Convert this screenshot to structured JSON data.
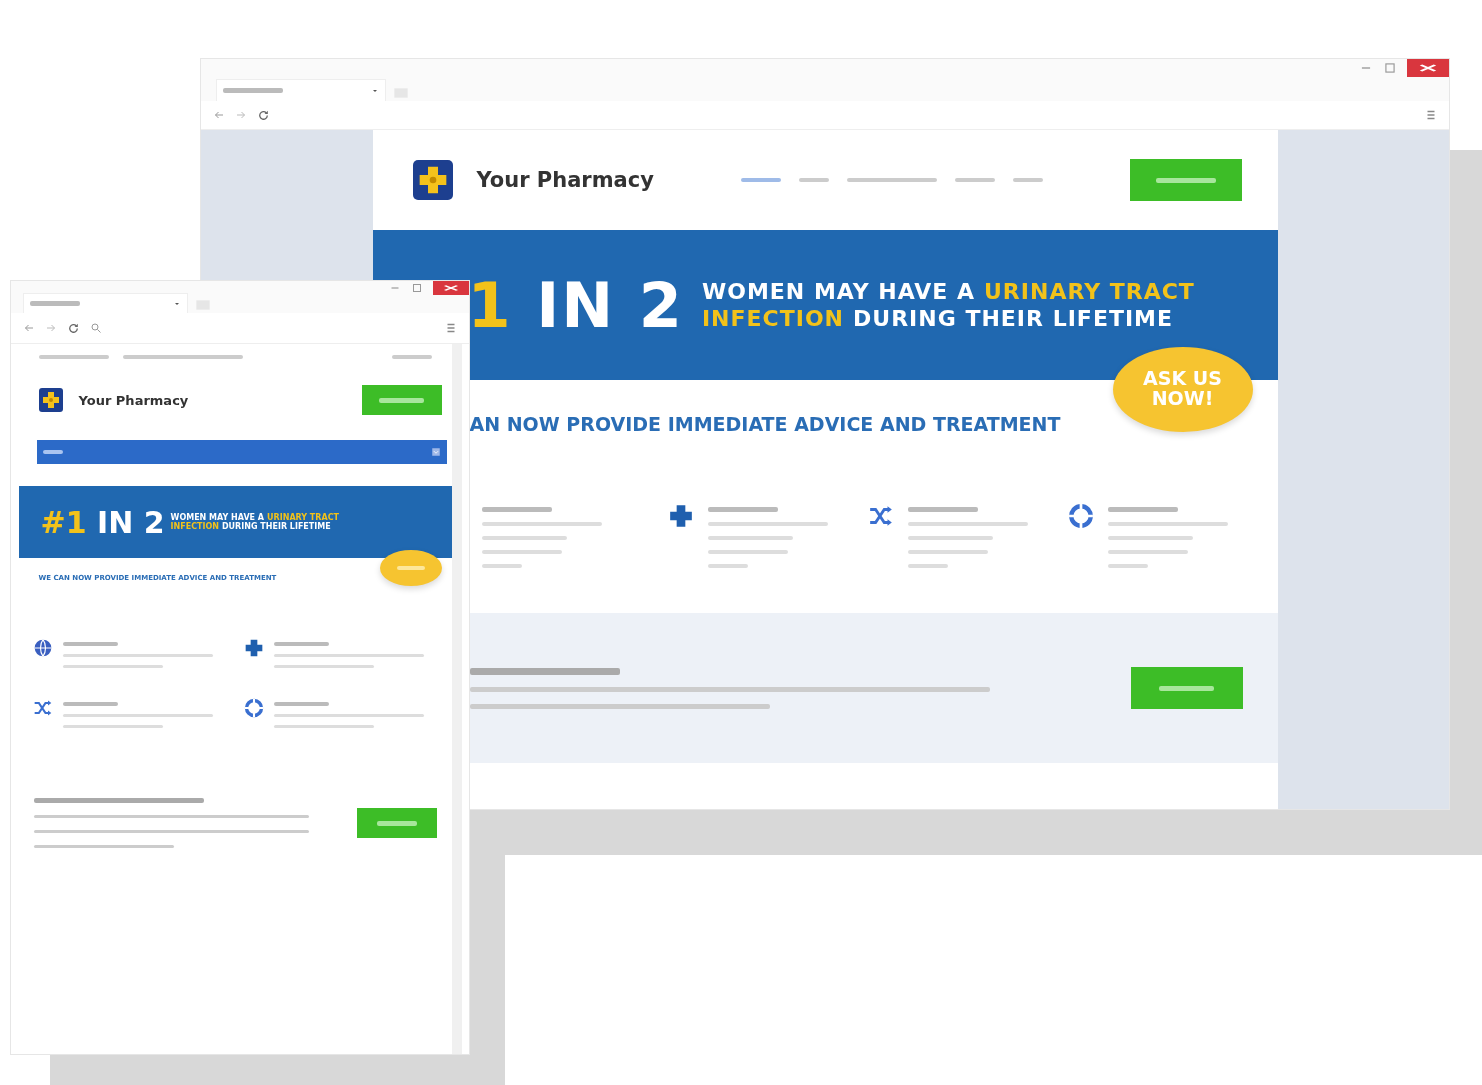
{
  "back_window": {
    "site_name": "Your Pharmacy",
    "banner": {
      "number": "1",
      "rest": "IN 2",
      "lines": [
        [
          {
            "text": "WOMEN MAY HAVE A",
            "highlight": false
          },
          {
            "text": "URINARY TRACT",
            "highlight": true
          }
        ],
        [
          {
            "text": "INFECTION",
            "highlight": true
          },
          {
            "text": "DURING THEIR LIFETIME",
            "highlight": false
          }
        ]
      ]
    },
    "tagline": "AN NOW PROVIDE IMMEDIATE ADVICE AND TREATMENT",
    "badge": "ASK US NOW!"
  },
  "front_window": {
    "site_name": "Your Pharmacy",
    "banner": {
      "number": "#1",
      "rest": "IN 2",
      "lines": [
        [
          {
            "text": "WOMEN MAY HAVE A",
            "highlight": false
          },
          {
            "text": "URINARY TRACT",
            "highlight": true
          }
        ],
        [
          {
            "text": "INFECTION",
            "highlight": true
          },
          {
            "text": "DURING THEIR LIFETIME",
            "highlight": false
          }
        ]
      ]
    },
    "tagline": "WE CAN NOW PROVIDE IMMEDIATE ADVICE AND TREATMENT"
  }
}
